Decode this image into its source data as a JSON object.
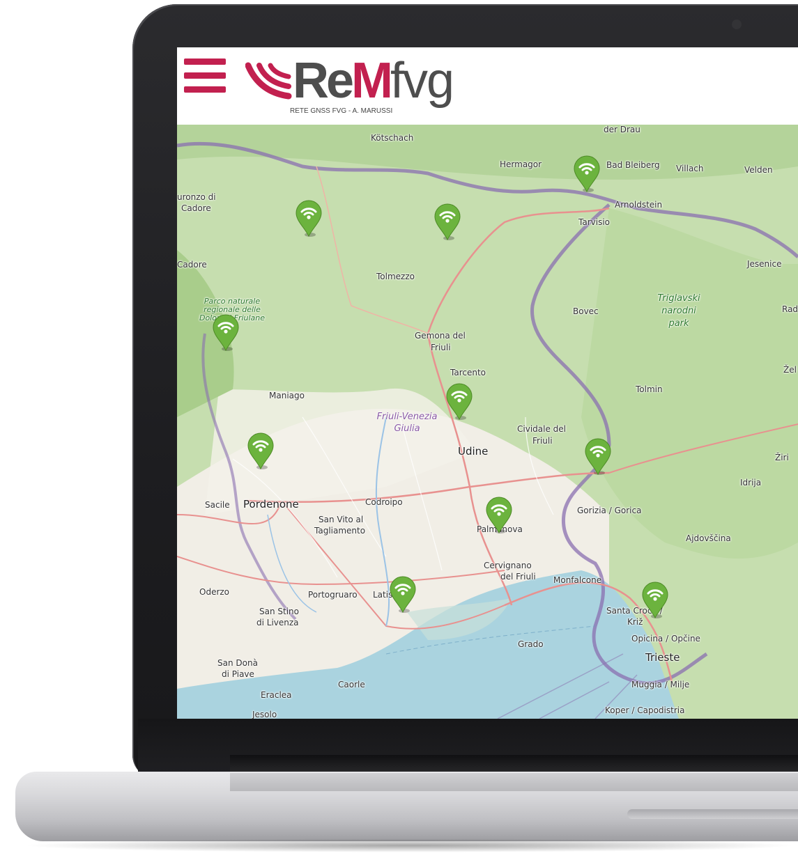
{
  "header": {
    "menu_icon": "hamburger-icon",
    "logo": {
      "re": "Re",
      "m": "M",
      "fvg": "fvg",
      "subtitle": "RETE GNSS FVG - A. MARUSSI",
      "brand_color": "#c2204f"
    }
  },
  "map": {
    "marker_icon": "gnss-station-wifi-icon",
    "marker_color": "#6cb33e",
    "places": [
      "der Drau",
      "Kötschach",
      "Hermagor",
      "Bad Bleiberg",
      "Villach",
      "Velden",
      "uronzo di",
      "Cadore",
      "Arnoldstein",
      "Tarvisio",
      "Cadore",
      "Tolmezzo",
      "Jesenice",
      "Bovec",
      "Rad",
      "Gemona del",
      "Friuli",
      "Tarcento",
      "Žel",
      "Maniago",
      "Tolmin",
      "Cividale del",
      "Friuli",
      "Udine",
      "Žiri",
      "Idrija",
      "Sacile",
      "Pordenone",
      "Codroipo",
      "San Vito al",
      "Tagliamento",
      "Gorizia / Gorica",
      "Palmanova",
      "Ajdovščina",
      "Cervignano",
      "del Friuli",
      "Monfalcone",
      "Oderzo",
      "Portogruaro",
      "Latisana",
      "San Stino",
      "di Livenza",
      "Santa Croce /",
      "Križ",
      "Opicina / Opčine",
      "Trieste",
      "Grado",
      "San Donà",
      "di Piave",
      "Caorle",
      "Eraclea",
      "Muggia / Milje",
      "Koper / Capodistria",
      "Jesolo"
    ],
    "region_label": "Friuli-Venezia Giulia",
    "park_1": "Parco naturale regionale delle Dolomiti Friulane",
    "park_2": "Triglavski narodni park"
  }
}
